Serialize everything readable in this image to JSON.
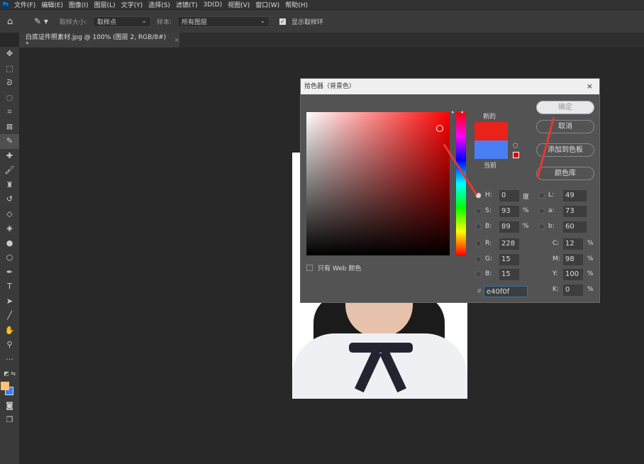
{
  "menubar": {
    "logo": "Ps",
    "items": [
      "文件(F)",
      "编辑(E)",
      "图像(I)",
      "图层(L)",
      "文字(Y)",
      "选择(S)",
      "滤镜(T)",
      "3D(D)",
      "视图(V)",
      "窗口(W)",
      "帮助(H)"
    ]
  },
  "options": {
    "sample_size_label": "取样大小:",
    "sample_size_value": "取样点",
    "sample_label": "样本:",
    "sample_value": "所有图层",
    "show_ring_label": "显示取样环",
    "show_ring_checked": true
  },
  "document_tab": {
    "title": "白底证件照素材.jpg @ 100% (图层 2, RGB/8#) *",
    "close": "×"
  },
  "colors": {
    "foreground": "#ffc07a",
    "background": "#3a7ef0",
    "new": "#e40f0f",
    "current": "#4a7ef5"
  },
  "dialog": {
    "title": "拾色器（背景色）",
    "close": "×",
    "new_label": "新的",
    "current_label": "当前",
    "buttons": {
      "ok": "确定",
      "cancel": "取消",
      "add_swatch": "添加到色板",
      "color_libraries": "颜色库"
    },
    "only_web_colors": "只有 Web 颜色",
    "fields": {
      "H": {
        "label": "H:",
        "value": "0",
        "unit": "度"
      },
      "S": {
        "label": "S:",
        "value": "93",
        "unit": "%"
      },
      "Bv": {
        "label": "B:",
        "value": "89",
        "unit": "%"
      },
      "R": {
        "label": "R:",
        "value": "228"
      },
      "G": {
        "label": "G:",
        "value": "15"
      },
      "Bc": {
        "label": "B:",
        "value": "15"
      },
      "L": {
        "label": "L:",
        "value": "49"
      },
      "a": {
        "label": "a:",
        "value": "73"
      },
      "b": {
        "label": "b:",
        "value": "60"
      },
      "C": {
        "label": "C:",
        "value": "12",
        "unit": "%"
      },
      "M": {
        "label": "M:",
        "value": "98",
        "unit": "%"
      },
      "Y": {
        "label": "Y:",
        "value": "100",
        "unit": "%"
      },
      "K": {
        "label": "K:",
        "value": "0",
        "unit": "%"
      },
      "hex": {
        "label": "#",
        "value": "e40f0f"
      }
    }
  }
}
